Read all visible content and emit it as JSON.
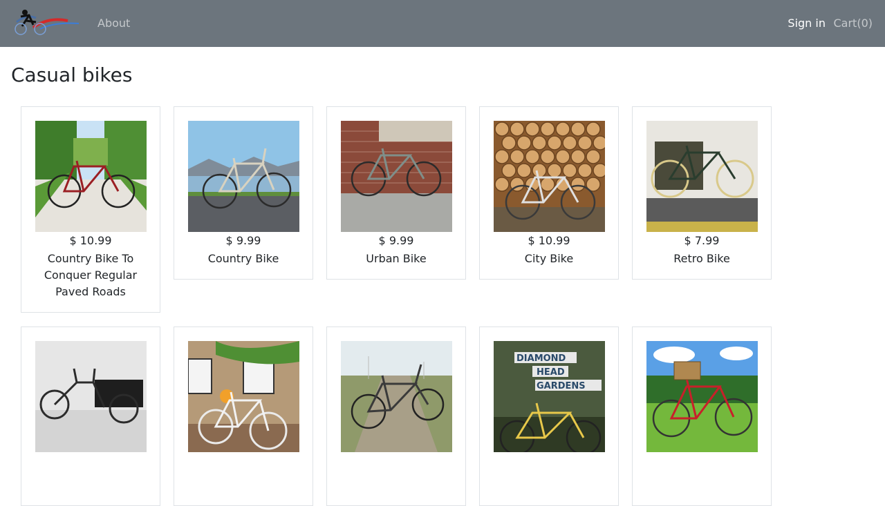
{
  "nav": {
    "about": "About",
    "sign_in": "Sign in",
    "cart": "Cart(0)"
  },
  "page": {
    "title": "Casual bikes"
  },
  "products": [
    {
      "price": "$ 10.99",
      "name": "Country Bike To Conquer Regular Paved Roads",
      "frame_color": "#9b1f24",
      "scene": "park"
    },
    {
      "price": "$ 9.99",
      "name": "Country Bike",
      "frame_color": "#d8d2c0",
      "scene": "lake"
    },
    {
      "price": "$ 9.99",
      "name": "Urban Bike",
      "frame_color": "#7f8f8a",
      "scene": "brick"
    },
    {
      "price": "$ 10.99",
      "name": "City Bike",
      "frame_color": "#e0e0e0",
      "scene": "logs"
    },
    {
      "price": "$ 7.99",
      "name": "Retro Bike",
      "frame_color": "#2a3d2e",
      "scene": "wall"
    },
    {
      "price": "",
      "name": "",
      "frame_color": "#2b2b2b",
      "scene": "studio"
    },
    {
      "price": "",
      "name": "",
      "frame_color": "#f2f2f2",
      "scene": "house"
    },
    {
      "price": "",
      "name": "",
      "frame_color": "#3a3a3a",
      "scene": "field"
    },
    {
      "price": "",
      "name": "",
      "frame_color": "#e8c84a",
      "scene": "sign",
      "sign_text": [
        "DIAMOND",
        "HEAD",
        "GARDENS"
      ]
    },
    {
      "price": "",
      "name": "",
      "frame_color": "#c8202a",
      "scene": "garden"
    }
  ]
}
